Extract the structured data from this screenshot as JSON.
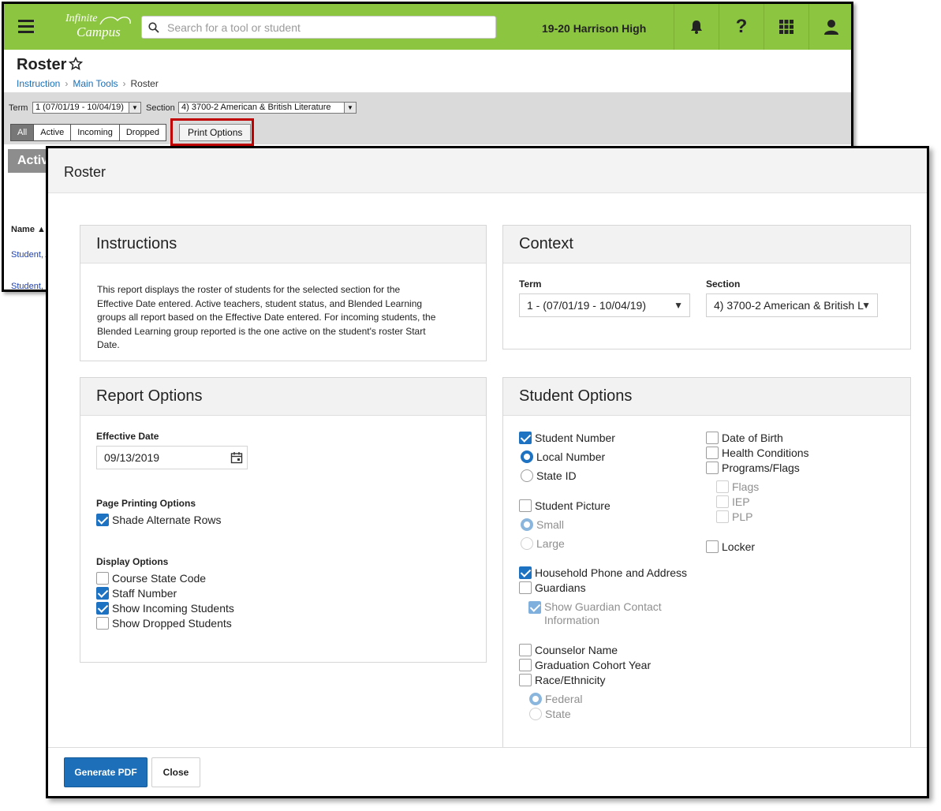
{
  "app": {
    "brand_line1": "Infinite",
    "brand_line2": "Campus",
    "search_placeholder": "Search for a tool or student",
    "school": "19-20 Harrison High",
    "page_title": "Roster",
    "breadcrumb": [
      "Instruction",
      "Main Tools",
      "Roster"
    ],
    "filters": {
      "term_label": "Term",
      "term_value": "1 (07/01/19 - 10/04/19)",
      "section_label": "Section",
      "section_value": "4) 3700-2 American & British Literature"
    },
    "tabs": [
      "All",
      "Active",
      "Incoming",
      "Dropped"
    ],
    "print_options": "Print Options",
    "active_header": "Activ",
    "col_name": "Name",
    "rows": [
      "Student, A",
      "Student, B"
    ],
    "accent_green": "#8cc540"
  },
  "modal": {
    "title": "Roster",
    "instructions": {
      "heading": "Instructions",
      "text": "This report displays the roster of students for the selected section for the Effective Date entered. Active teachers, student status, and Blended Learning groups all report based on the Effective Date entered. For incoming students, the Blended Learning group reported is the one active on the student's roster Start Date."
    },
    "context": {
      "heading": "Context",
      "term_label": "Term",
      "term_value": "1 - (07/01/19 - 10/04/19)",
      "section_label": "Section",
      "section_value": "4) 3700-2 American & British L"
    },
    "report_options": {
      "heading": "Report Options",
      "effective_date_label": "Effective Date",
      "effective_date": "09/13/2019",
      "page_printing_label": "Page Printing Options",
      "shade_rows": "Shade Alternate Rows",
      "display_label": "Display Options",
      "course_state_code": "Course State Code",
      "staff_number": "Staff Number",
      "show_incoming": "Show Incoming Students",
      "show_dropped": "Show Dropped Students"
    },
    "student_options": {
      "heading": "Student Options",
      "student_number": "Student Number",
      "local_number": "Local Number",
      "state_id": "State ID",
      "student_picture": "Student Picture",
      "small": "Small",
      "large": "Large",
      "household": "Household Phone and Address",
      "guardians": "Guardians",
      "guardian_contact_1": "Show Guardian Contact",
      "guardian_contact_2": "Information",
      "counselor": "Counselor Name",
      "grad_cohort": "Graduation Cohort Year",
      "race": "Race/Ethnicity",
      "federal": "Federal",
      "state": "State",
      "dob": "Date of Birth",
      "health": "Health Conditions",
      "programs": "Programs/Flags",
      "flags": "Flags",
      "iep": "IEP",
      "plp": "PLP",
      "locker": "Locker"
    },
    "footer": {
      "generate": "Generate PDF",
      "close": "Close"
    },
    "primary_color": "#1d6fb9"
  }
}
